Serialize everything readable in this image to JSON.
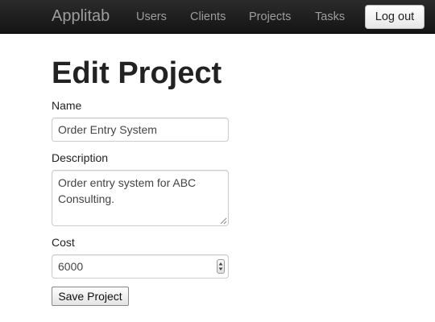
{
  "navbar": {
    "brand": "Applitab",
    "links": [
      "Users",
      "Clients",
      "Projects",
      "Tasks"
    ],
    "logout_label": "Log out"
  },
  "page": {
    "title": "Edit Project"
  },
  "form": {
    "name_label": "Name",
    "name_value": "Order Entry System",
    "description_label": "Description",
    "description_value": "Order entry system for ABC Consulting.",
    "cost_label": "Cost",
    "cost_value": "6000",
    "submit_label": "Save Project"
  }
}
